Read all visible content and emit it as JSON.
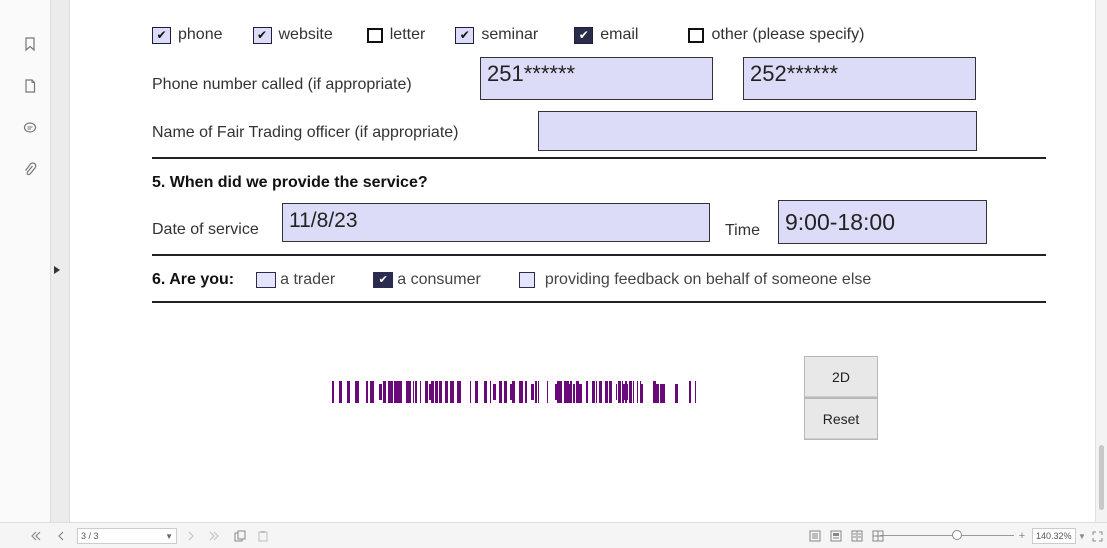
{
  "contact_methods": [
    {
      "label": "phone",
      "checked": true
    },
    {
      "label": "website",
      "checked": true
    },
    {
      "label": "letter",
      "checked": false
    },
    {
      "label": "seminar",
      "checked": true
    },
    {
      "label": "email",
      "checked": true
    },
    {
      "label": "other (please specify)",
      "checked": false
    }
  ],
  "phone_row": {
    "label": "Phone number called (if appropriate)",
    "value1": "251******",
    "value2": "252******"
  },
  "officer_row": {
    "label": "Name of Fair Trading officer (if appropriate)",
    "value": ""
  },
  "section5": {
    "heading": "5.  When did we provide the service?",
    "date_label": "Date of service",
    "date_value": "11/8/23",
    "time_label": "Time",
    "time_value": "9:00-18:00"
  },
  "section6": {
    "heading": "6.  Are you:",
    "options": [
      {
        "label": "a trader",
        "checked": false
      },
      {
        "label": "a consumer",
        "checked": true
      },
      {
        "label": "providing feedback on behalf of someone else",
        "checked": false
      }
    ]
  },
  "buttons": {
    "twod": "2D",
    "reset": "Reset"
  },
  "statusbar": {
    "page_indicator": "3 / 3",
    "zoom_value": "140.32%"
  },
  "icons": {
    "bookmark": "bookmark-icon",
    "pages": "pages-icon",
    "comments": "comment-icon",
    "attachments": "paperclip-icon"
  },
  "colors": {
    "field_fill": "#dcdcf8",
    "barcode": "#6a0a7a"
  }
}
